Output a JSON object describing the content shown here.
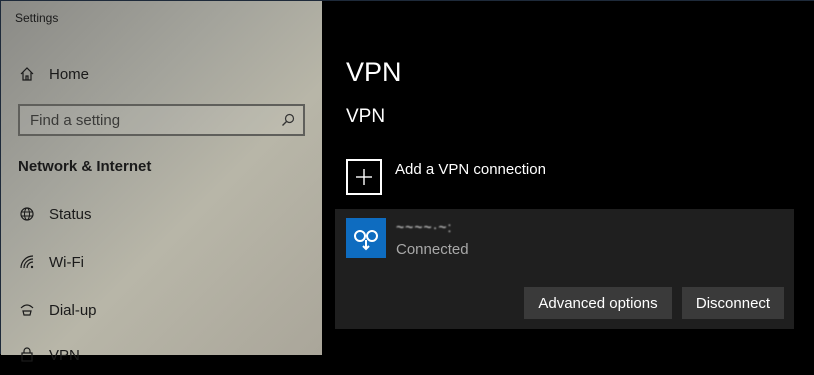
{
  "window": {
    "title": "Settings"
  },
  "sidebar": {
    "home_label": "Home",
    "search_placeholder": "Find a setting",
    "section_title": "Network & Internet",
    "items": [
      {
        "label": "Status",
        "icon": "globe-icon"
      },
      {
        "label": "Wi-Fi",
        "icon": "wifi-icon"
      },
      {
        "label": "Dial-up",
        "icon": "dialup-icon"
      },
      {
        "label": "VPN",
        "icon": "vpn-icon"
      }
    ]
  },
  "main": {
    "page_title": "VPN",
    "section_title": "VPN",
    "add_label": "Add a VPN connection",
    "connection": {
      "name": "~~~~·~:",
      "status": "Connected",
      "icon": "vpn-connection-icon",
      "advanced_label": "Advanced options",
      "disconnect_label": "Disconnect"
    }
  },
  "colors": {
    "accent": "#0e6cc0",
    "card_bg": "#1f1f1f",
    "button_bg": "#3a3a3a",
    "main_bg": "#000000"
  }
}
